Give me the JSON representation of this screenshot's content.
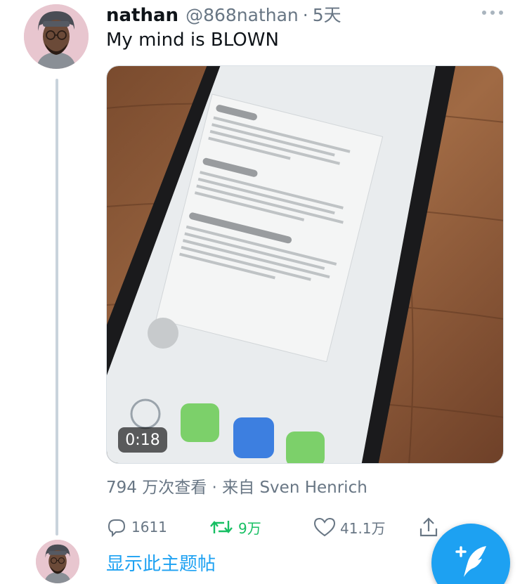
{
  "tweet": {
    "display_name": "nathan",
    "handle": "@868nathan",
    "separator": "·",
    "time": "5天",
    "text": "My mind is BLOWN",
    "more_icon": "more-horizontal-icon",
    "media": {
      "type": "video",
      "duration": "0:18"
    },
    "meta": "794 万次查看 · 来自 Sven Henrich",
    "actions": {
      "reply": {
        "icon": "reply-icon",
        "count": "1611"
      },
      "retweet": {
        "icon": "retweet-icon",
        "count": "9万",
        "color": "#17bf63"
      },
      "like": {
        "icon": "heart-icon",
        "count": "41.1万"
      },
      "share": {
        "icon": "share-icon"
      }
    }
  },
  "show_thread_label": "显示此主题帖",
  "compose_button": {
    "icon": "compose-tweet-icon",
    "color": "#1da1f2"
  },
  "colors": {
    "accent": "#1da1f2",
    "secondary_text": "#687684",
    "retweet_green": "#17bf63"
  }
}
